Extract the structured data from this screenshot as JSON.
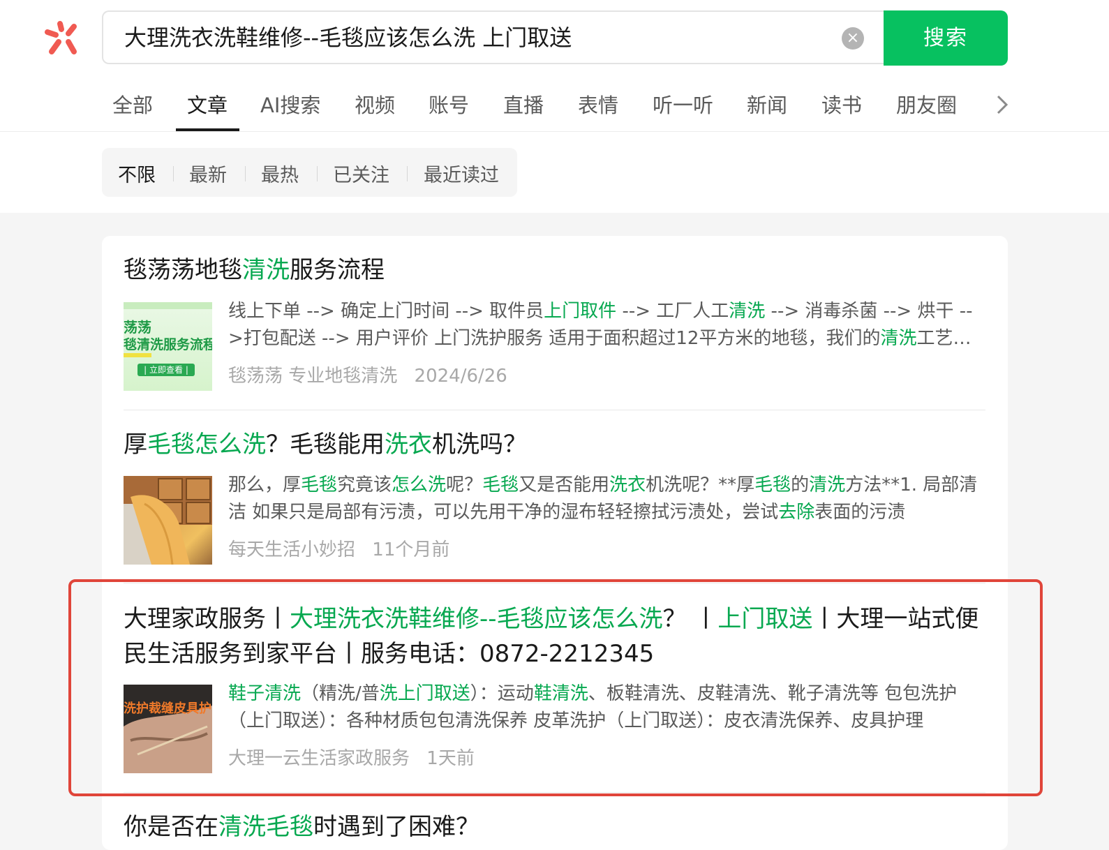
{
  "search": {
    "query": "大理洗衣洗鞋维修--毛毯应该怎么洗 上门取送",
    "button_label": "搜索",
    "clear_icon": "×"
  },
  "tabs": [
    {
      "label": "全部"
    },
    {
      "label": "文章"
    },
    {
      "label": "AI搜索"
    },
    {
      "label": "视频"
    },
    {
      "label": "账号"
    },
    {
      "label": "直播"
    },
    {
      "label": "表情"
    },
    {
      "label": "听一听"
    },
    {
      "label": "新闻"
    },
    {
      "label": "读书"
    },
    {
      "label": "朋友圈"
    }
  ],
  "filters": [
    {
      "label": "不限"
    },
    {
      "label": "最新"
    },
    {
      "label": "最热"
    },
    {
      "label": "已关注"
    },
    {
      "label": "最近读过"
    }
  ],
  "colors": {
    "accent": "#07c160",
    "highlight_text": "#07a850",
    "annotation_box": "#e0453a"
  },
  "results": [
    {
      "title": [
        {
          "t": "毯荡荡地毯"
        },
        {
          "t": "清洗",
          "hl": true
        },
        {
          "t": "服务流程"
        }
      ],
      "thumb_text": {
        "line1": "荡荡",
        "line2": "毯清洗服务流程",
        "button": "| 立即查看 |"
      },
      "snippet": [
        {
          "t": "线上下单 --> 确定上门时间 --> 取件员"
        },
        {
          "t": "上门取件",
          "hl": true
        },
        {
          "t": " --> 工厂人工"
        },
        {
          "t": "清洗",
          "hl": true
        },
        {
          "t": " --> 消毒杀菌 --> 烘干 -->打包配送 --> 用户评价 上门洗护服务 适用于面积超过12平方米的地毯，我们的"
        },
        {
          "t": "清洗",
          "hl": true
        },
        {
          "t": "工艺采用专业设备"
        }
      ],
      "source": "毯荡荡 专业地毯清洗",
      "date": "2024/6/26"
    },
    {
      "title": [
        {
          "t": "厚"
        },
        {
          "t": "毛毯怎么洗",
          "hl": true
        },
        {
          "t": "？毛毯能用"
        },
        {
          "t": "洗衣",
          "hl": true
        },
        {
          "t": "机洗吗？"
        }
      ],
      "snippet": [
        {
          "t": "那么，厚"
        },
        {
          "t": "毛毯",
          "hl": true
        },
        {
          "t": "究竟该"
        },
        {
          "t": "怎么洗",
          "hl": true
        },
        {
          "t": "呢？"
        },
        {
          "t": "毛毯",
          "hl": true
        },
        {
          "t": "又是否能用"
        },
        {
          "t": "洗衣",
          "hl": true
        },
        {
          "t": "机洗呢？**厚"
        },
        {
          "t": "毛毯",
          "hl": true
        },
        {
          "t": "的"
        },
        {
          "t": "清洗",
          "hl": true
        },
        {
          "t": "方法**1. 局部清洁 如果只是局部有污渍，可以先用干净的湿布轻轻擦拭污渍处，尝试"
        },
        {
          "t": "去除",
          "hl": true
        },
        {
          "t": "表面的污渍"
        }
      ],
      "source": "每天生活小妙招",
      "date": "11个月前"
    },
    {
      "title": [
        {
          "t": "大理家政服务丨"
        },
        {
          "t": "大理洗衣洗鞋维修--毛毯应该怎么洗",
          "hl": true
        },
        {
          "t": "？ 丨"
        },
        {
          "t": "上门取送",
          "hl": true
        },
        {
          "t": "丨大理一站式便民生活服务到家平台丨服务电话：0872-2212345"
        }
      ],
      "thumb_text": {
        "line1": "洗护裁缝皮具护"
      },
      "snippet": [
        {
          "t": "鞋子清洗",
          "hl": true
        },
        {
          "t": "（精洗/普"
        },
        {
          "t": "洗上门取送",
          "hl": true
        },
        {
          "t": "）：运动"
        },
        {
          "t": "鞋清洗",
          "hl": true
        },
        {
          "t": "、板鞋清洗、皮鞋清洗、靴子清洗等 包包洗护（上门取送）：各种材质包包清洗保养 皮革洗护（上门取送）：皮衣清洗保养、皮具护理"
        }
      ],
      "source": "大理一云生活家政服务",
      "date": "1天前"
    },
    {
      "title": [
        {
          "t": "你是否在"
        },
        {
          "t": "清洗毛毯",
          "hl": true
        },
        {
          "t": "时遇到了困难？"
        }
      ]
    }
  ]
}
